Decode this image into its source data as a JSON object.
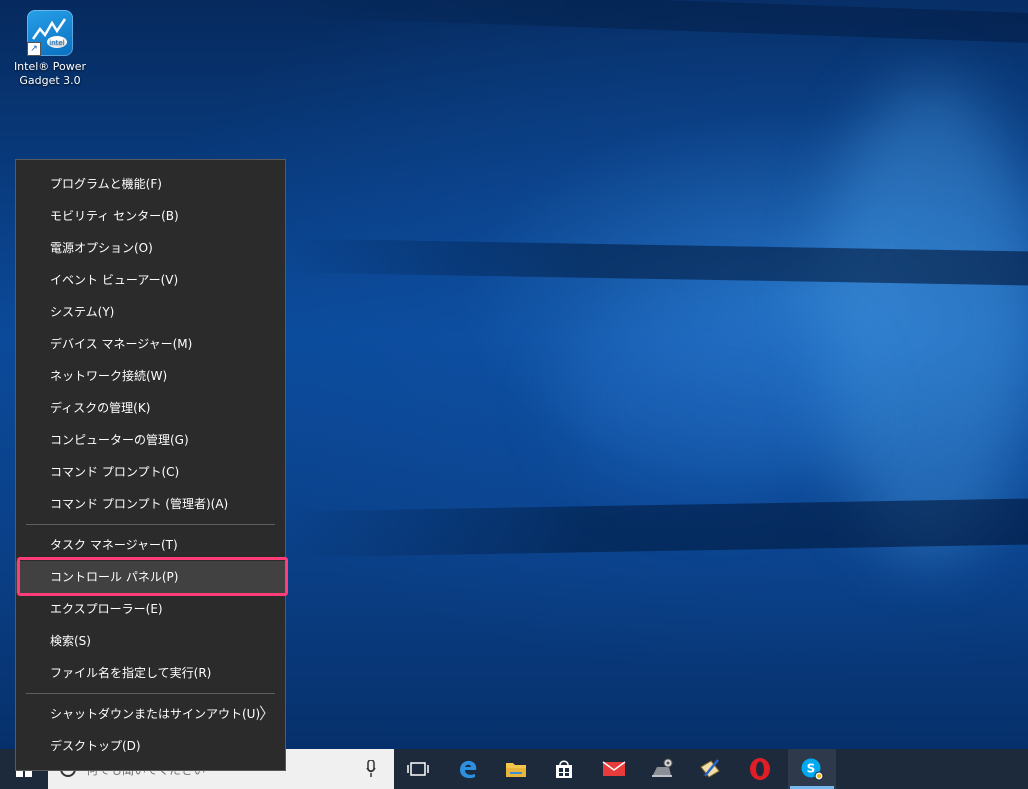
{
  "desktop": {
    "icon": {
      "line1": "Intel® Power",
      "line2": "Gadget 3.0",
      "tile_text": "intel"
    }
  },
  "menu": {
    "group1": [
      {
        "name": "menu-item-programs-features",
        "label": "プログラムと機能(F)"
      },
      {
        "name": "menu-item-mobility-center",
        "label": "モビリティ センター(B)"
      },
      {
        "name": "menu-item-power-options",
        "label": "電源オプション(O)"
      },
      {
        "name": "menu-item-event-viewer",
        "label": "イベント ビューアー(V)"
      },
      {
        "name": "menu-item-system",
        "label": "システム(Y)"
      },
      {
        "name": "menu-item-device-manager",
        "label": "デバイス マネージャー(M)"
      },
      {
        "name": "menu-item-network-connections",
        "label": "ネットワーク接続(W)"
      },
      {
        "name": "menu-item-disk-management",
        "label": "ディスクの管理(K)"
      },
      {
        "name": "menu-item-computer-management",
        "label": "コンピューターの管理(G)"
      },
      {
        "name": "menu-item-command-prompt",
        "label": "コマンド プロンプト(C)"
      },
      {
        "name": "menu-item-command-prompt-admin",
        "label": "コマンド プロンプト (管理者)(A)"
      }
    ],
    "group2": [
      {
        "name": "menu-item-task-manager",
        "label": "タスク マネージャー(T)"
      },
      {
        "name": "menu-item-control-panel",
        "label": "コントロール パネル(P)"
      },
      {
        "name": "menu-item-explorer",
        "label": "エクスプローラー(E)"
      },
      {
        "name": "menu-item-search",
        "label": "検索(S)"
      },
      {
        "name": "menu-item-run",
        "label": "ファイル名を指定して実行(R)"
      }
    ],
    "group3": [
      {
        "name": "menu-item-shutdown-signout",
        "label": "シャットダウンまたはサインアウト(U)"
      },
      {
        "name": "menu-item-desktop",
        "label": "デスクトップ(D)"
      }
    ],
    "submenu_arrow": "〉"
  },
  "taskbar": {
    "search_placeholder": "何でも聞いてください"
  },
  "colors": {
    "menu_bg": "#2b2b2b",
    "highlight_border": "#ff3d7a",
    "taskbar_bg": "#1d2a3c"
  }
}
